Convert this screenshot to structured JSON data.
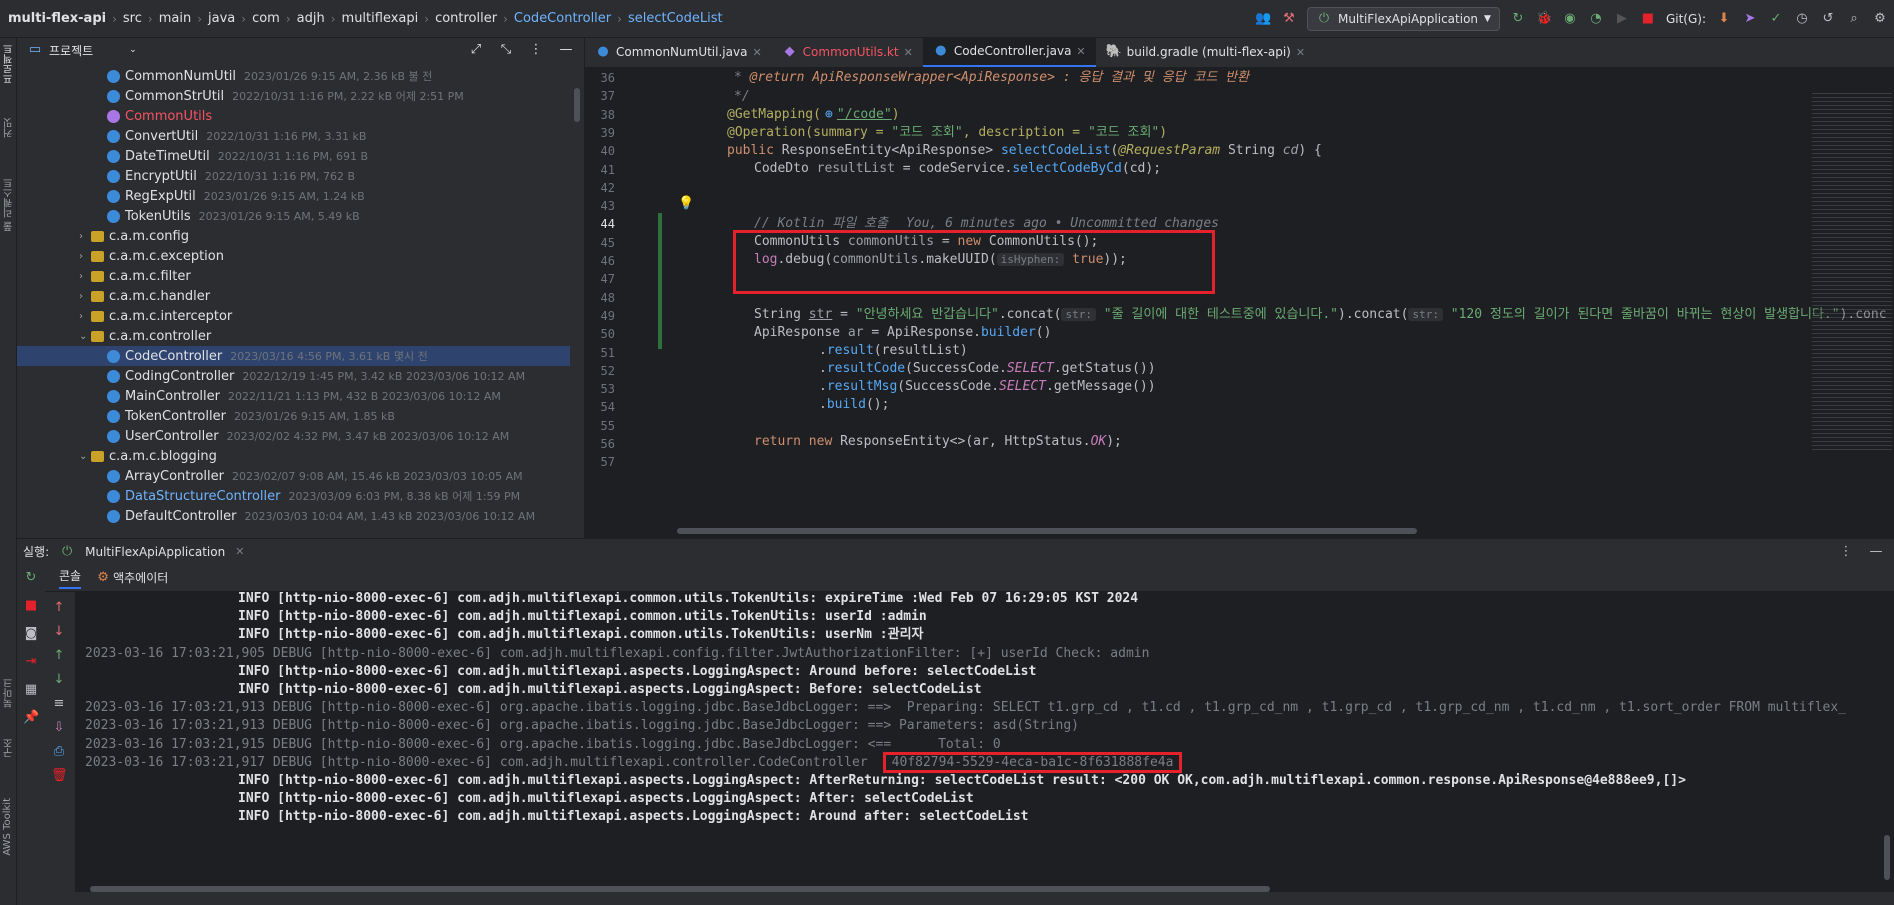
{
  "breadcrumb": [
    "multi-flex-api",
    "src",
    "main",
    "java",
    "com",
    "adjh",
    "multiflexapi",
    "controller",
    "CodeController",
    "selectCodeList"
  ],
  "toolbar": {
    "run_config": "MultiFlexApiApplication",
    "git_label": "Git(G):"
  },
  "project_panel": {
    "title": "프로젝트"
  },
  "tree": [
    {
      "name": "CommonNumUtil",
      "meta": "2023/01/26 9:15 AM, 2.36 kB 불 전",
      "kind": "class",
      "indent": 2
    },
    {
      "name": "CommonStrUtil",
      "meta": "2022/10/31 1:16 PM, 2.22 kB 어제 2:51 PM",
      "kind": "class",
      "indent": 2
    },
    {
      "name": "CommonUtils",
      "meta": "",
      "kind": "class-red",
      "indent": 2
    },
    {
      "name": "ConvertUtil",
      "meta": "2022/10/31 1:16 PM, 3.31 kB",
      "kind": "class",
      "indent": 2
    },
    {
      "name": "DateTimeUtil",
      "meta": "2022/10/31 1:16 PM, 691 B",
      "kind": "class",
      "indent": 2
    },
    {
      "name": "EncryptUtil",
      "meta": "2022/10/31 1:16 PM, 762 B",
      "kind": "class",
      "indent": 2
    },
    {
      "name": "RegExpUtil",
      "meta": "2023/01/26 9:15 AM, 1.24 kB",
      "kind": "class",
      "indent": 2
    },
    {
      "name": "TokenUtils",
      "meta": "2023/01/26 9:15 AM, 5.49 kB",
      "kind": "class",
      "indent": 2
    },
    {
      "name": "c.a.m.config",
      "meta": "",
      "kind": "pkg-closed",
      "indent": 1
    },
    {
      "name": "c.a.m.c.exception",
      "meta": "",
      "kind": "pkg-closed",
      "indent": 1
    },
    {
      "name": "c.a.m.c.filter",
      "meta": "",
      "kind": "pkg-closed",
      "indent": 1
    },
    {
      "name": "c.a.m.c.handler",
      "meta": "",
      "kind": "pkg-closed",
      "indent": 1
    },
    {
      "name": "c.a.m.c.interceptor",
      "meta": "",
      "kind": "pkg-closed",
      "indent": 1
    },
    {
      "name": "c.a.m.controller",
      "meta": "",
      "kind": "pkg-open",
      "indent": 1
    },
    {
      "name": "CodeController",
      "meta": "2023/03/16 4:56 PM, 3.61 kB 몇시 전",
      "kind": "class-sel",
      "indent": 2
    },
    {
      "name": "CodingController",
      "meta": "2022/12/19 1:45 PM, 3.42 kB 2023/03/06 10:12 AM",
      "kind": "class",
      "indent": 2
    },
    {
      "name": "MainController",
      "meta": "2022/11/21 1:13 PM, 432 B 2023/03/06 10:12 AM",
      "kind": "class",
      "indent": 2
    },
    {
      "name": "TokenController",
      "meta": "2023/01/26 9:15 AM, 1.85 kB",
      "kind": "class",
      "indent": 2
    },
    {
      "name": "UserController",
      "meta": "2023/02/02 4:32 PM, 3.47 kB 2023/03/06 10:12 AM",
      "kind": "class",
      "indent": 2
    },
    {
      "name": "c.a.m.c.blogging",
      "meta": "",
      "kind": "pkg-open",
      "indent": 1
    },
    {
      "name": "ArrayController",
      "meta": "2023/02/07 9:08 AM, 15.46 kB 2023/03/03 10:05 AM",
      "kind": "class",
      "indent": 2
    },
    {
      "name": "DataStructureController",
      "meta": "2023/03/09 6:03 PM, 8.38 kB 어제 1:59 PM",
      "kind": "class-blue",
      "indent": 2
    },
    {
      "name": "DefaultController",
      "meta": "2023/03/03 10:04 AM, 1.43 kB 2023/03/06 10:12 AM",
      "kind": "class",
      "indent": 2
    }
  ],
  "tabs": [
    {
      "label": "CommonNumUtil.java",
      "state": "normal"
    },
    {
      "label": "CommonUtils.kt",
      "state": "red"
    },
    {
      "label": "CodeController.java",
      "state": "active"
    },
    {
      "label": "build.gradle (multi-flex-api)",
      "state": "normal"
    }
  ],
  "editor": {
    "line_numbers": [
      "36",
      "37",
      "38",
      "39",
      "40",
      "41",
      "42",
      "43",
      "44",
      "45",
      "46",
      "47",
      "48",
      "49",
      "50",
      "51",
      "52",
      "53",
      "54",
      "55",
      "56",
      "57"
    ],
    "warnings": "15",
    "lines": {
      "l36": "@return ApiResponseWrapper<ApiResponse> : 응답 결과 및 응답 코드 반환",
      "l37": "*/",
      "l38a": "@GetMapping(",
      "l38b": "\"/code\"",
      "l38c": ")",
      "l39a": "@Operation(summary = ",
      "l39b": "\"코드 조회\"",
      "l39c": ", description = ",
      "l39d": "\"코드 조회\"",
      "l39e": ")",
      "l40a": "public ",
      "l40b": "ResponseEntity<ApiResponse> ",
      "l40c": "selectCodeList",
      "l40d": "(",
      "l40e": "@RequestParam ",
      "l40f": "String ",
      "l40g": "cd",
      "l40h": ") {",
      "l41a": "CodeDto ",
      "l41b": "resultList",
      "l41c": " = codeService.",
      "l41d": "selectCodeByCd",
      "l41e": "(cd);",
      "l44a": "// Kotlin 파일 호출",
      "l44b": "You, 6 minutes ago • Uncommitted changes",
      "l45a": "CommonUtils ",
      "l45b": "commonUtils",
      "l45c": " = ",
      "l45d": "new ",
      "l45e": "CommonUtils();",
      "l46a": "log",
      "l46b": ".debug(",
      "l46c": "commonUtils",
      "l46d": ".makeUUID(",
      "l46e": "isHyphen:",
      "l46f": " true",
      "l46g": "));",
      "l49a": "String ",
      "l49b": "str",
      "l49c": " = ",
      "l49d": "\"안녕하세요 반갑습니다\"",
      "l49e": ".concat(",
      "l49f": "str:",
      "l49g": " \"줄 길이에 대한 테스트중에 있습니다.\"",
      "l49h": ").concat(",
      "l49i": "str:",
      "l49j": " \"120 정도의 길이가 된다면 줄바꿈이 바뀌는 현상이 발생합니다.\"",
      "l49k": ").conc",
      "l50a": "ApiResponse ",
      "l50b": "ar",
      "l50c": " = ApiResponse.",
      "l50d": "builder",
      "l50e": "()",
      "l51a": ".",
      "l51b": "result",
      "l51c": "(resultList)",
      "l52a": ".",
      "l52b": "resultCode",
      "l52c": "(SuccessCode.",
      "l52d": "SELECT",
      "l52e": ".getStatus())",
      "l53a": ".",
      "l53b": "resultMsg",
      "l53c": "(SuccessCode.",
      "l53d": "SELECT",
      "l53e": ".getMessage())",
      "l54a": ".",
      "l54b": "build",
      "l54c": "();",
      "l56a": "return ",
      "l56b": "new ",
      "l56c": "ResponseEntity<>(ar, HttpStatus.",
      "l56d": "OK",
      "l56e": ");"
    }
  },
  "run_panel": {
    "label": "실행:",
    "app_tab": "MultiFlexApiApplication",
    "console_tab": "콘솔",
    "actuator_tab": "액추에이터",
    "logs": [
      {
        "level": "INFO",
        "text": " [http-nio-8000-exec-6] com.adjh.multiflexapi.common.utils.TokenUtils: expireTime :Wed Feb 07 16:29:05 KST 2024",
        "kind": "info"
      },
      {
        "level": "INFO",
        "text": " [http-nio-8000-exec-6] com.adjh.multiflexapi.common.utils.TokenUtils: userId :admin",
        "kind": "info"
      },
      {
        "level": "INFO",
        "text": " [http-nio-8000-exec-6] com.adjh.multiflexapi.common.utils.TokenUtils: userNm :관리자",
        "kind": "info"
      },
      {
        "level": "",
        "text": "2023-03-16 17:03:21,905 DEBUG [http-nio-8000-exec-6] com.adjh.multiflexapi.config.filter.JwtAuthorizationFilter: [+] userId Check: admin",
        "kind": "dbg"
      },
      {
        "level": "INFO",
        "text": " [http-nio-8000-exec-6] com.adjh.multiflexapi.aspects.LoggingAspect: Around before: selectCodeList",
        "kind": "info"
      },
      {
        "level": "INFO",
        "text": " [http-nio-8000-exec-6] com.adjh.multiflexapi.aspects.LoggingAspect: Before: selectCodeList",
        "kind": "info"
      },
      {
        "level": "",
        "text": "2023-03-16 17:03:21,913 DEBUG [http-nio-8000-exec-6] org.apache.ibatis.logging.jdbc.BaseJdbcLogger: ==>  Preparing: SELECT t1.grp_cd , t1.cd , t1.grp_cd_nm , t1.grp_cd , t1.grp_cd_nm , t1.cd_nm , t1.sort_order FROM multiflex_",
        "kind": "dbg"
      },
      {
        "level": "",
        "text": "2023-03-16 17:03:21,913 DEBUG [http-nio-8000-exec-6] org.apache.ibatis.logging.jdbc.BaseJdbcLogger: ==> Parameters: asd(String)",
        "kind": "dbg"
      },
      {
        "level": "",
        "text": "2023-03-16 17:03:21,915 DEBUG [http-nio-8000-exec-6] org.apache.ibatis.logging.jdbc.BaseJdbcLogger: <==      Total: 0",
        "kind": "dbg"
      },
      {
        "level": "",
        "text": "2023-03-16 17:03:21,917 DEBUG [http-nio-8000-exec-6] com.adjh.multiflexapi.controller.CodeController",
        "kind": "dbg-uuid",
        "uuid": "40f82794-5529-4eca-ba1c-8f631888fe4a"
      },
      {
        "level": "INFO",
        "text": " [http-nio-8000-exec-6] com.adjh.multiflexapi.aspects.LoggingAspect: AfterReturning: selectCodeList result: <200 OK OK,com.adjh.multiflexapi.common.response.ApiResponse@4e888ee9,[]>",
        "kind": "info"
      },
      {
        "level": "INFO",
        "text": " [http-nio-8000-exec-6] com.adjh.multiflexapi.aspects.LoggingAspect: After: selectCodeList",
        "kind": "info"
      },
      {
        "level": "INFO",
        "text": " [http-nio-8000-exec-6] com.adjh.multiflexapi.aspects.LoggingAspect: Around after: selectCodeList",
        "kind": "info"
      }
    ]
  },
  "left_stripe": {
    "project": "프로젝트",
    "commit": "커밋",
    "pull": "풀 리퀘스트",
    "bookmarks": "북마크",
    "structure": "구조",
    "aws": "AWS Toolkit"
  },
  "colors": {
    "accent": "#3574f0",
    "highlight_box": "#e5212b",
    "selected_row": "#2e436e"
  }
}
